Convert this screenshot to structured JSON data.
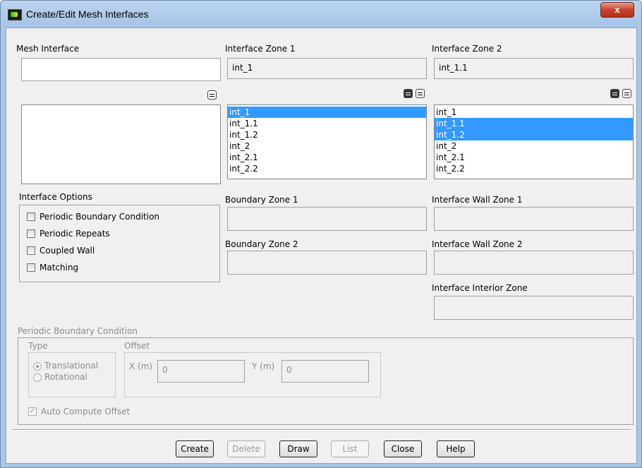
{
  "window": {
    "title": "Create/Edit Mesh Interfaces",
    "close_glyph": "x"
  },
  "mesh_interface": {
    "label": "Mesh Interface",
    "value": ""
  },
  "zone1": {
    "label": "Interface Zone 1",
    "value": "int_1"
  },
  "zone2": {
    "label": "Interface Zone 2",
    "value": "int_1.1"
  },
  "list_zone1": [
    {
      "text": "int_1",
      "selected": true
    },
    {
      "text": "int_1.1",
      "selected": false
    },
    {
      "text": "int_1.2",
      "selected": false
    },
    {
      "text": "int_2",
      "selected": false
    },
    {
      "text": "int_2.1",
      "selected": false
    },
    {
      "text": "int_2.2",
      "selected": false
    }
  ],
  "list_zone2": [
    {
      "text": "int_1",
      "selected": false
    },
    {
      "text": "int_1.1",
      "selected": true
    },
    {
      "text": "int_1.2",
      "selected": true
    },
    {
      "text": "int_2",
      "selected": false
    },
    {
      "text": "int_2.1",
      "selected": false
    },
    {
      "text": "int_2.2",
      "selected": false
    }
  ],
  "interface_options": {
    "label": "Interface Options",
    "items": [
      {
        "label": "Periodic Boundary Condition",
        "checked": false
      },
      {
        "label": "Periodic Repeats",
        "checked": false
      },
      {
        "label": "Coupled Wall",
        "checked": false
      },
      {
        "label": "Matching",
        "checked": false
      }
    ]
  },
  "boundary_zone1": {
    "label": "Boundary Zone 1",
    "value": ""
  },
  "boundary_zone2": {
    "label": "Boundary Zone 2",
    "value": ""
  },
  "interface_wall_zone1": {
    "label": "Interface Wall Zone 1",
    "value": ""
  },
  "interface_wall_zone2": {
    "label": "Interface Wall Zone 2",
    "value": ""
  },
  "interface_interior_zone": {
    "label": "Interface Interior Zone",
    "value": ""
  },
  "periodic": {
    "label": "Periodic Boundary Condition",
    "type_label": "Type",
    "translational": "Translational",
    "rotational": "Rotational",
    "offset_label": "Offset",
    "x_label": "X (m)",
    "x_value": "0",
    "y_label": "Y (m)",
    "y_value": "0",
    "auto_compute": "Auto Compute Offset",
    "auto_check_glyph": "✓"
  },
  "buttons": {
    "create": "Create",
    "delete": "Delete",
    "draw": "Draw",
    "list": "List",
    "close": "Close",
    "help": "Help"
  },
  "colors": {
    "selection": "#3399ff",
    "dialog_bg": "#f0f0f0",
    "close_red": "#c8412c"
  }
}
